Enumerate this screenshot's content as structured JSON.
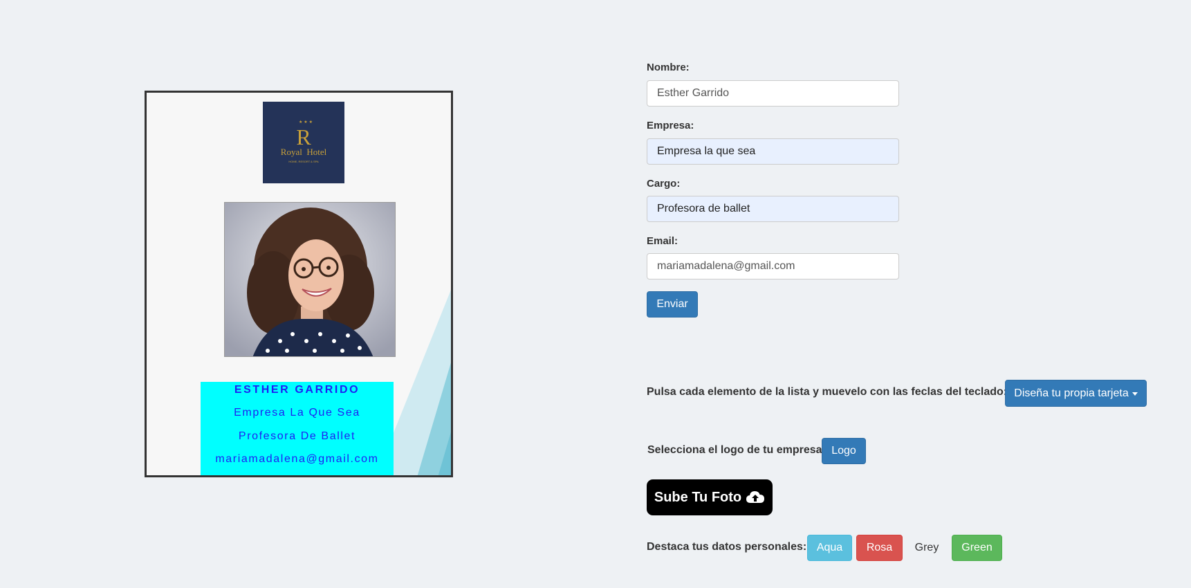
{
  "card": {
    "logo": {
      "letter": "R",
      "name": "Royal  Hotel",
      "tagline": "HOME, RESORT & SPA"
    },
    "photo_alt": "foto",
    "info": {
      "name": "ESTHER GARRIDO",
      "company": "Empresa La Que Sea",
      "role": "Profesora De Ballet",
      "email": "mariamadalena@gmail.com"
    },
    "colors": {
      "info_bg": "#00ffff",
      "info_text": "#1f1ff2",
      "logo_bg": "#243358",
      "logo_gold": "#c9a13a"
    }
  },
  "form": {
    "nombre": {
      "label": "Nombre:",
      "value": "Esther Garrido"
    },
    "empresa": {
      "label": "Empresa:",
      "value": "Empresa la que sea"
    },
    "cargo": {
      "label": "Cargo:",
      "value": "Profesora de ballet"
    },
    "email": {
      "label": "Email:",
      "value": "mariamadalena@gmail.com"
    },
    "submit_label": "Enviar"
  },
  "controls": {
    "move_instruction": "Pulsa cada elemento de la lista y muevelo con las feclas del teclado:",
    "design_dropdown_label": "Diseña tu propia tarjeta",
    "logo_instruction": "Selecciona el logo de tu empresa",
    "logo_button_label": "Logo",
    "upload_label": "Sube Tu Foto",
    "upload_icon": "cloud-upload-icon",
    "highlight_label": "Destaca tus datos personales:",
    "color_buttons": [
      {
        "label": "Aqua",
        "color": "#5bc0de"
      },
      {
        "label": "Rosa",
        "color": "#d9534f"
      },
      {
        "label": "Grey",
        "color": "transparent"
      },
      {
        "label": "Green",
        "color": "#5cb85c"
      }
    ]
  }
}
